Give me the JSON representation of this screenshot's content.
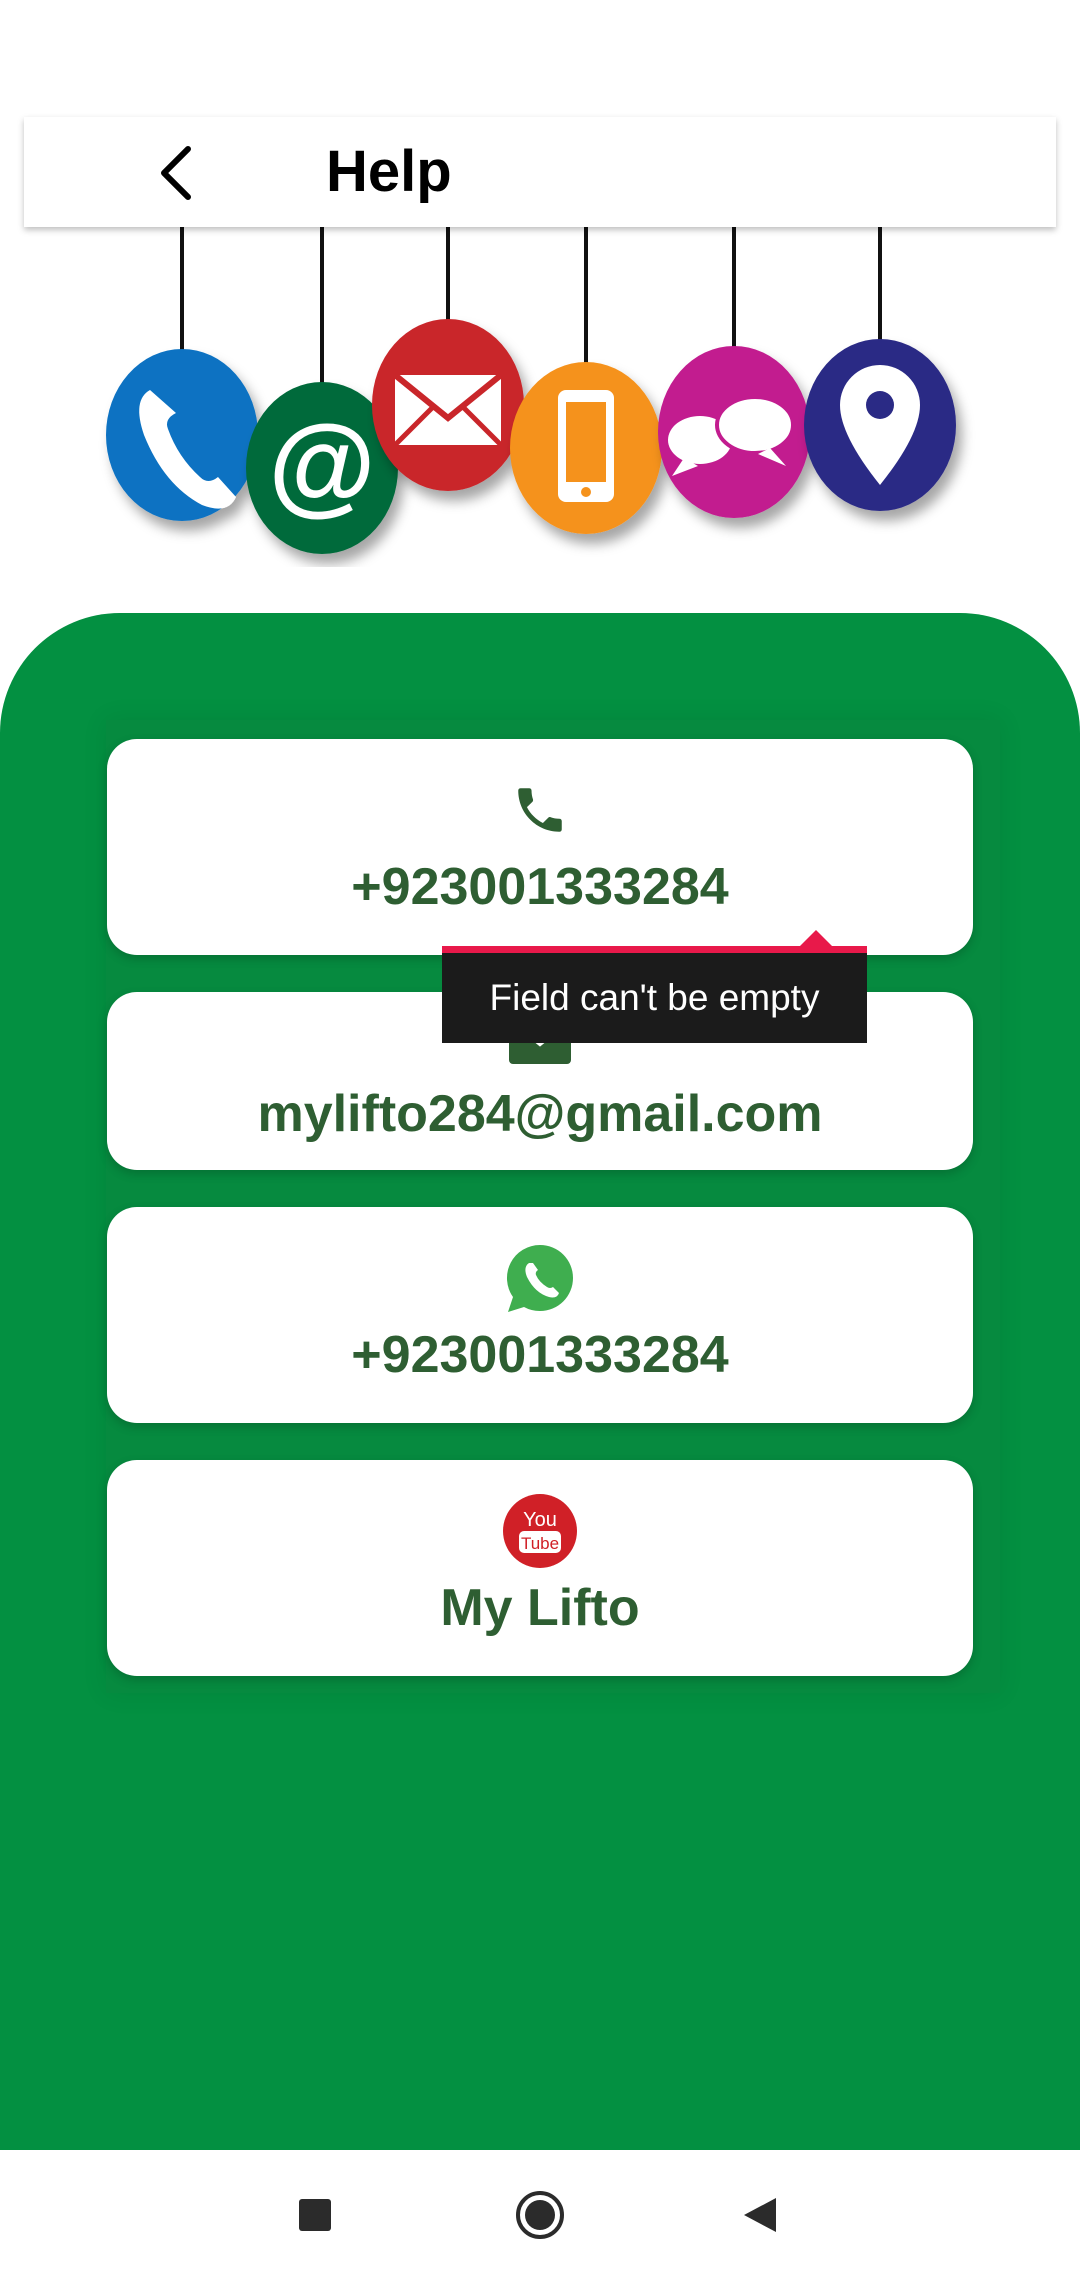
{
  "header": {
    "title": "Help"
  },
  "tooltip": {
    "text": "Field can't be empty"
  },
  "contacts": {
    "phone": {
      "value": "+923001333284",
      "icon": "phone-icon"
    },
    "email": {
      "value": "mylifto284@gmail.com",
      "icon": "mail-icon"
    },
    "whatsapp": {
      "value": "+923001333284",
      "icon": "whatsapp-icon"
    },
    "youtube": {
      "value": "My Lifto",
      "icon": "youtube-icon",
      "icon_text_top": "You",
      "icon_text_bottom": "Tube"
    }
  },
  "colors": {
    "accent_green": "#039041",
    "text_green": "#2e5e32",
    "tooltip_bar": "#e8194a",
    "badge_phone": "#0a72c2",
    "badge_at": "#046a3a",
    "badge_mail": "#c9262c",
    "badge_mobile": "#f5921e",
    "badge_chat": "#c21b8f",
    "badge_location": "#2b2a85"
  },
  "navbar": {
    "icons": [
      "recents-square-icon",
      "home-circle-icon",
      "back-triangle-icon"
    ]
  }
}
